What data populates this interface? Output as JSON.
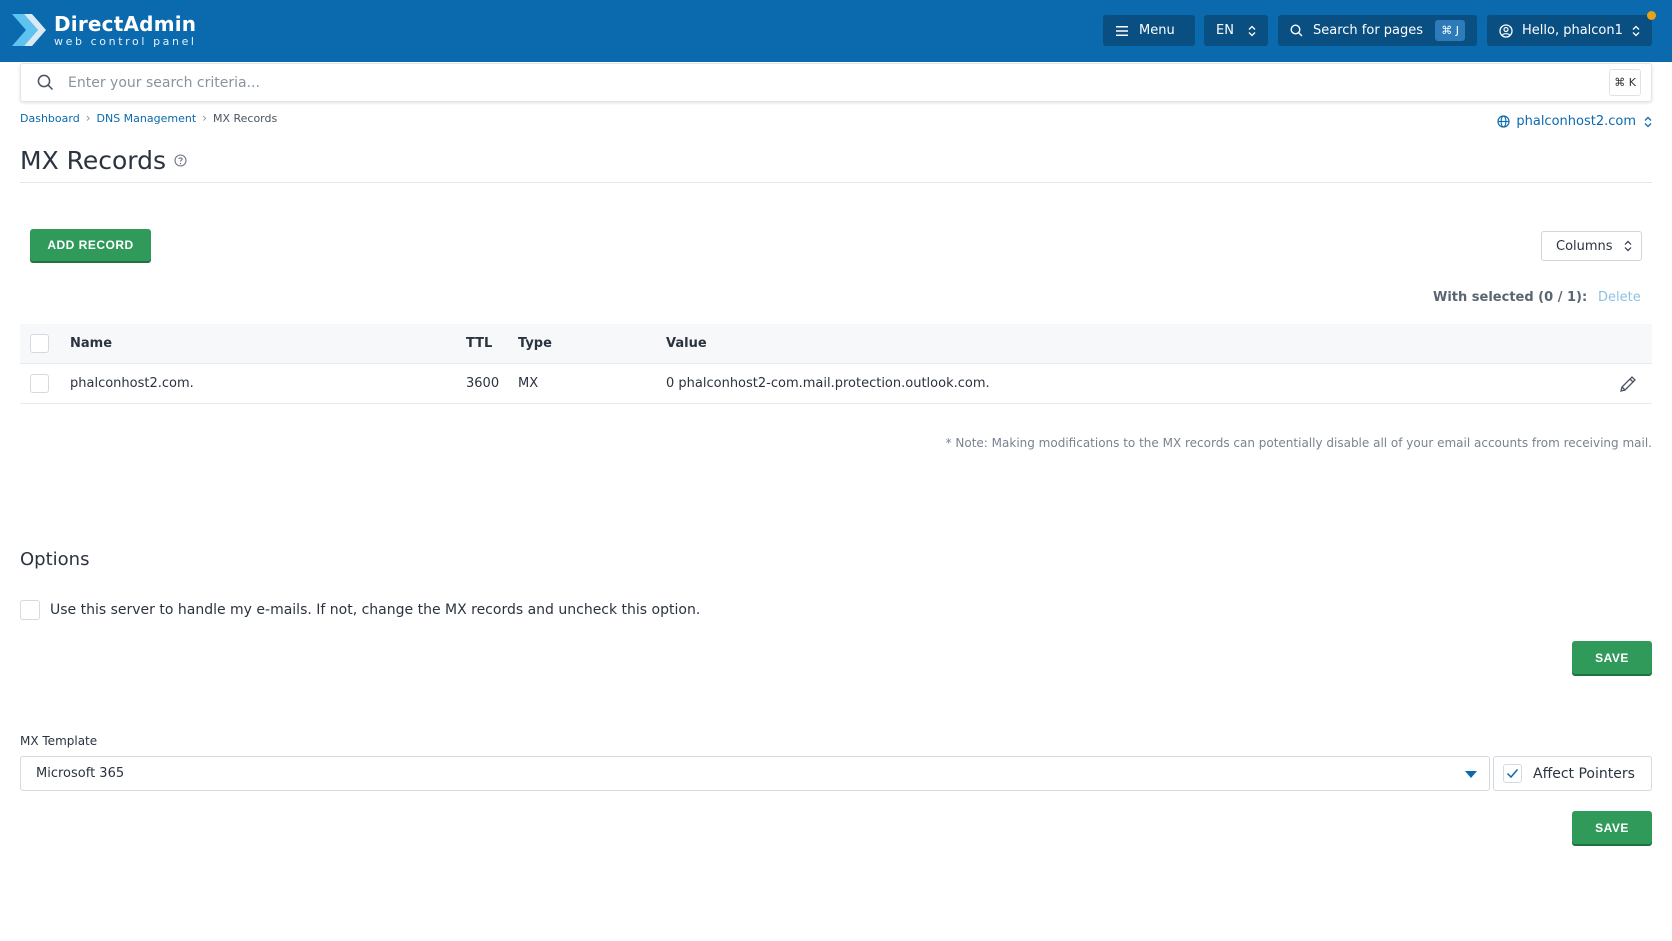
{
  "header": {
    "logo_title": "DirectAdmin",
    "logo_subtitle": "web control panel",
    "menu_label": "Menu",
    "language": "EN",
    "search_pages_label": "Search for pages",
    "search_pages_shortcut": "⌘ J",
    "user_greeting": "Hello, phalcon1",
    "brand_color": "#0b6aad"
  },
  "search": {
    "placeholder": "Enter your search criteria...",
    "shortcut": "⌘ K"
  },
  "breadcrumb": {
    "items": [
      "Dashboard",
      "DNS Management",
      "MX Records"
    ]
  },
  "domain_selector": {
    "value": "phalconhost2.com"
  },
  "page": {
    "title": "MX Records"
  },
  "toolbar": {
    "add_record_label": "ADD RECORD",
    "columns_label": "Columns",
    "with_selected_label": "With selected (0 / 1):",
    "delete_label": "Delete"
  },
  "table": {
    "columns": [
      "Name",
      "TTL",
      "Type",
      "Value"
    ],
    "rows": [
      {
        "name": "phalconhost2.com.",
        "ttl": "3600",
        "type": "MX",
        "value": "0 phalconhost2-com.mail.protection.outlook.com."
      }
    ]
  },
  "note": "* Note: Making modifications to the MX records can potentially disable all of your email accounts from receiving mail.",
  "options": {
    "title": "Options",
    "local_mail_label": "Use this server to handle my e-mails. If not, change the MX records and uncheck this option.",
    "local_mail_checked": false,
    "save_label": "SAVE"
  },
  "mx_template": {
    "label": "MX Template",
    "selected": "Microsoft 365",
    "affect_pointers_label": "Affect Pointers",
    "affect_pointers_checked": true,
    "save_label": "SAVE"
  },
  "colors": {
    "accent_green": "#2f9a5a",
    "notification": "#e9a11a"
  }
}
